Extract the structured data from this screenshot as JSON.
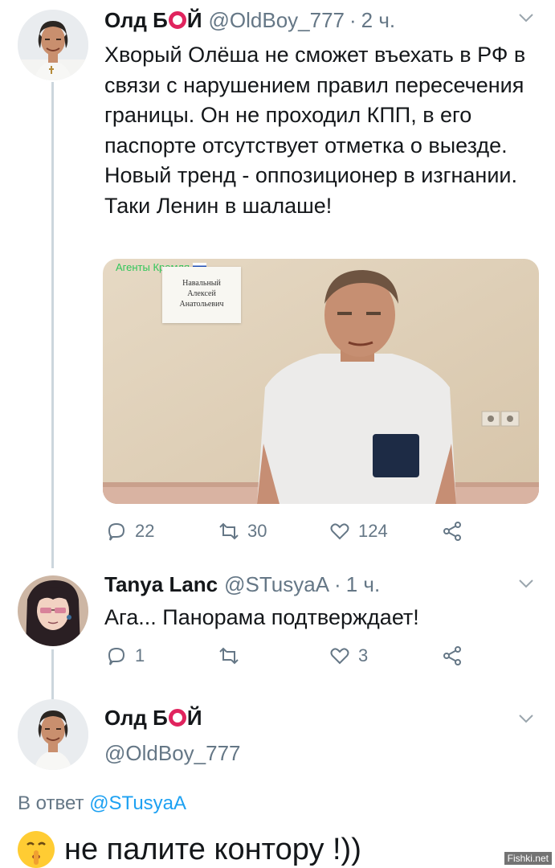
{
  "tweet1": {
    "name_part1": "Олд Б",
    "name_part2": "Й",
    "handle": "@OldBoy_777",
    "dot": "·",
    "time": "2 ч.",
    "text": "Хворый Олёша не сможет въехать в РФ в связи с нарушением правил пересечения границы. Он не проходил КПП,  в его паспорте отсутствует отметка о выезде. Новый тренд - оппозиционер в изгнании. Таки Ленин в шалаше!",
    "media": {
      "watermark": "Агенты Кремля",
      "paper_lines": [
        "Навальный",
        "Алексей",
        "Анатольевич"
      ]
    },
    "actions": {
      "replies": "22",
      "retweets": "30",
      "likes": "124"
    }
  },
  "tweet2": {
    "name": "Tanya Lanc",
    "handle": "@STusyaA",
    "dot": "·",
    "time": "1 ч.",
    "text": "Ага... Панорама подтверждает!",
    "actions": {
      "replies": "1",
      "retweets": "",
      "likes": "3"
    }
  },
  "tweet3": {
    "name_part1": "Олд Б",
    "name_part2": "Й",
    "handle": "@OldBoy_777",
    "reply_prefix": "В ответ",
    "reply_mention": "@STusyaA",
    "text": "не палите контору !))"
  },
  "footer": {
    "watermark": "Fishki.net"
  },
  "colors": {
    "accent": "#1da1f2",
    "muted": "#657786",
    "line": "#ccd6dd",
    "ring": "#e0245e"
  }
}
